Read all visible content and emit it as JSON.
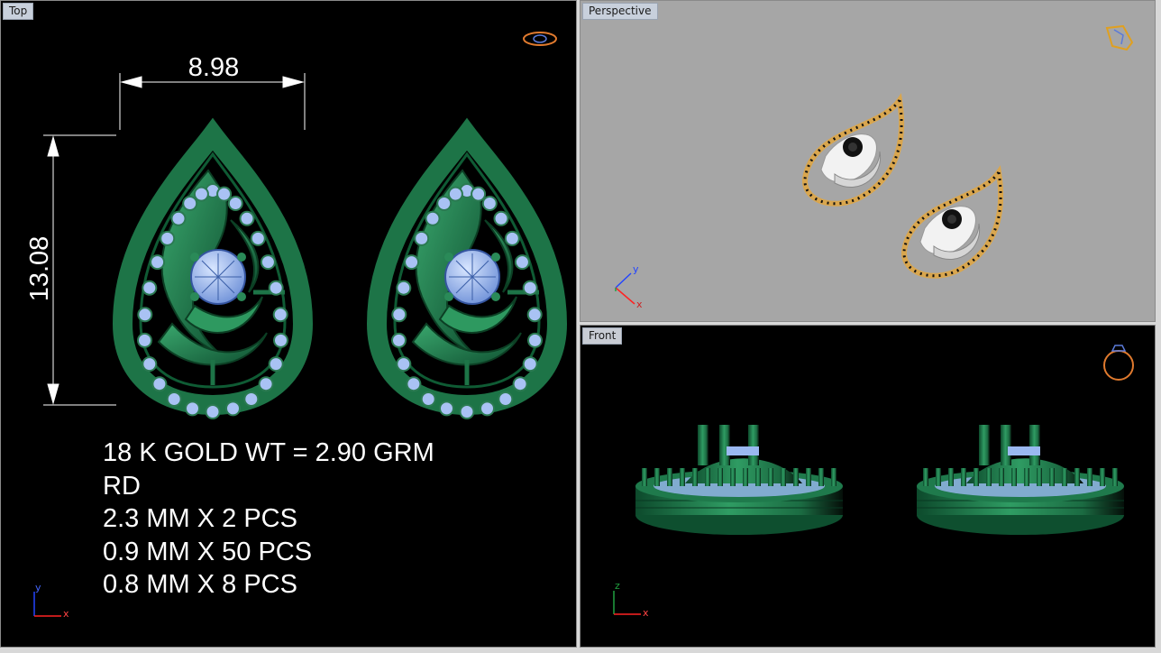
{
  "viewports": {
    "top": {
      "label": "Top"
    },
    "perspective": {
      "label": "Perspective"
    },
    "front": {
      "label": "Front"
    }
  },
  "dimensions": {
    "width": "8.98",
    "height": "13.08"
  },
  "specs": {
    "line1": "18 K GOLD WT = 2.90 GRM",
    "line2": "RD",
    "line3": "2.3 MM X 2 PCS",
    "line4": "0.9 MM X 50 PCS",
    "line5": "0.8 MM X 8 PCS"
  },
  "axes": {
    "top": {
      "y": "y",
      "x": "x"
    },
    "perspective": {
      "y": "y",
      "x": "x"
    },
    "front": {
      "y": "z",
      "x": "x"
    }
  },
  "colors": {
    "metal_green": "#1f7a4c",
    "stone_blue": "#9ab8f0",
    "gold": "#e4b45a",
    "viewport_gray": "#a6a6a6"
  },
  "icons": {
    "top": "ring-top-icon",
    "perspective": "ring-perspective-icon",
    "front": "ring-front-icon"
  }
}
